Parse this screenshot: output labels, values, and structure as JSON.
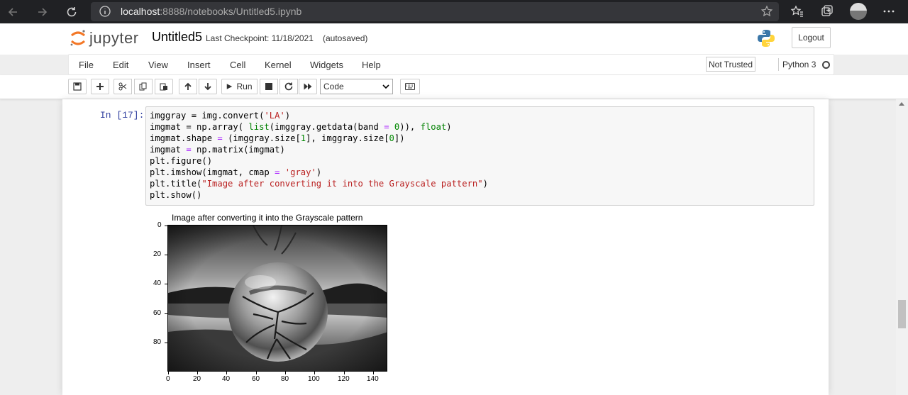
{
  "browser": {
    "url_host": "localhost",
    "url_path": ":8888/notebooks/Untitled5.ipynb"
  },
  "header": {
    "logo_text": "jupyter",
    "notebook_name": "Untitled5",
    "checkpoint": "Last Checkpoint: 11/18/2021",
    "autosaved": "(autosaved)",
    "logout_label": "Logout"
  },
  "menubar": {
    "items": [
      "File",
      "Edit",
      "View",
      "Insert",
      "Cell",
      "Kernel",
      "Widgets",
      "Help"
    ],
    "not_trusted": "Not Trusted",
    "kernel_name": "Python 3"
  },
  "toolbar": {
    "run_label": "Run",
    "cell_type": "Code"
  },
  "cell": {
    "prompt": "In [17]:",
    "code_lines": [
      "imggray = img.convert('LA')",
      "imgmat = np.array( list(imggray.getdata(band = 0)), float)",
      "imgmat.shape = (imggray.size[1], imggray.size[0])",
      "imgmat = np.matrix(imgmat)",
      "plt.figure()",
      "plt.imshow(imgmat, cmap = 'gray')",
      "plt.title(\"Image after converting it into the Grayscale pattern\")",
      "plt.show()"
    ]
  },
  "chart_data": {
    "type": "heatmap",
    "title": "Image after converting it into the Grayscale pattern",
    "colormap": "gray",
    "xlabel": "",
    "ylabel": "",
    "xlim": [
      0,
      150
    ],
    "ylim": [
      100,
      0
    ],
    "x_ticks": [
      "0",
      "20",
      "40",
      "60",
      "80",
      "100",
      "120",
      "140"
    ],
    "y_ticks": [
      "0",
      "20",
      "40",
      "60",
      "80"
    ]
  }
}
